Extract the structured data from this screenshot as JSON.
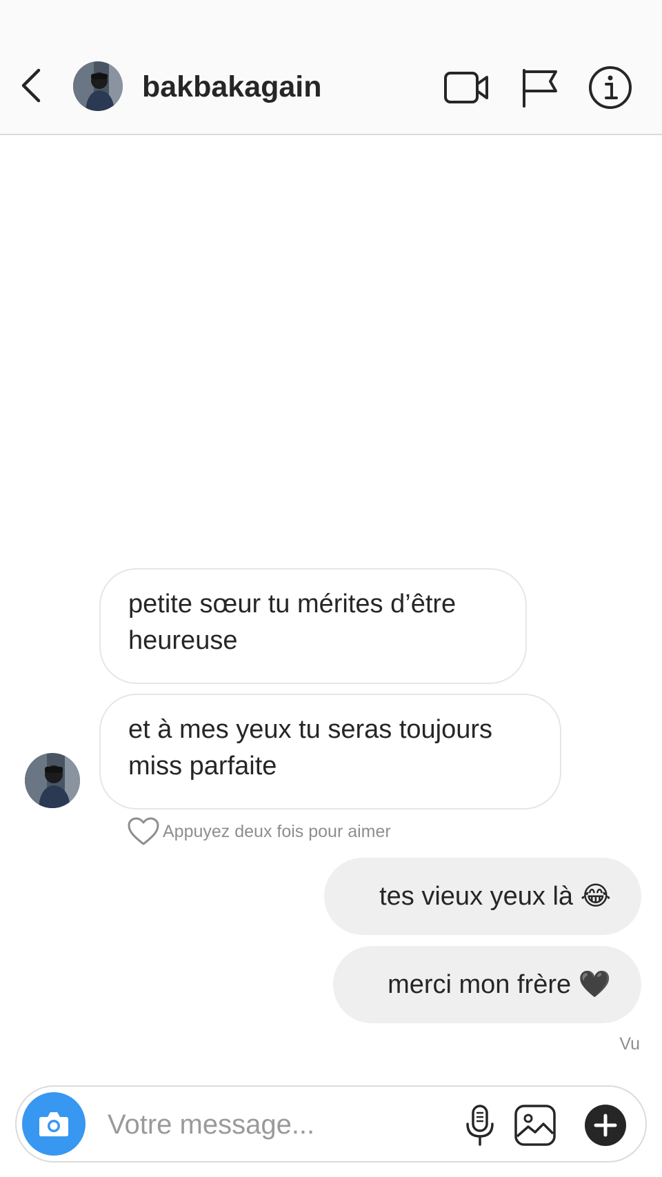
{
  "header": {
    "username": "bakbakagain",
    "icons": [
      "back-chevron-icon",
      "video-call-icon",
      "flag-icon",
      "info-icon"
    ]
  },
  "messages": [
    {
      "direction": "incoming",
      "text": "petite sœur tu mérites d’être heureuse"
    },
    {
      "direction": "incoming",
      "text": "et à mes yeux tu seras toujours miss parfaite"
    },
    {
      "direction": "outgoing",
      "text": "tes vieux yeux là 😂"
    },
    {
      "direction": "outgoing",
      "text": "merci mon frère 🖤"
    }
  ],
  "like_hint": "Appuyez deux fois pour aimer",
  "seen_label": "Vu",
  "composer": {
    "placeholder": "Votre message...",
    "icons": [
      "camera-icon",
      "microphone-icon",
      "gallery-icon",
      "plus-icon"
    ]
  },
  "colors": {
    "accent": "#3897f0",
    "outgoing_bubble": "#efefef",
    "header_bg": "#fafafa",
    "secondary_text": "#8e8e8e"
  }
}
